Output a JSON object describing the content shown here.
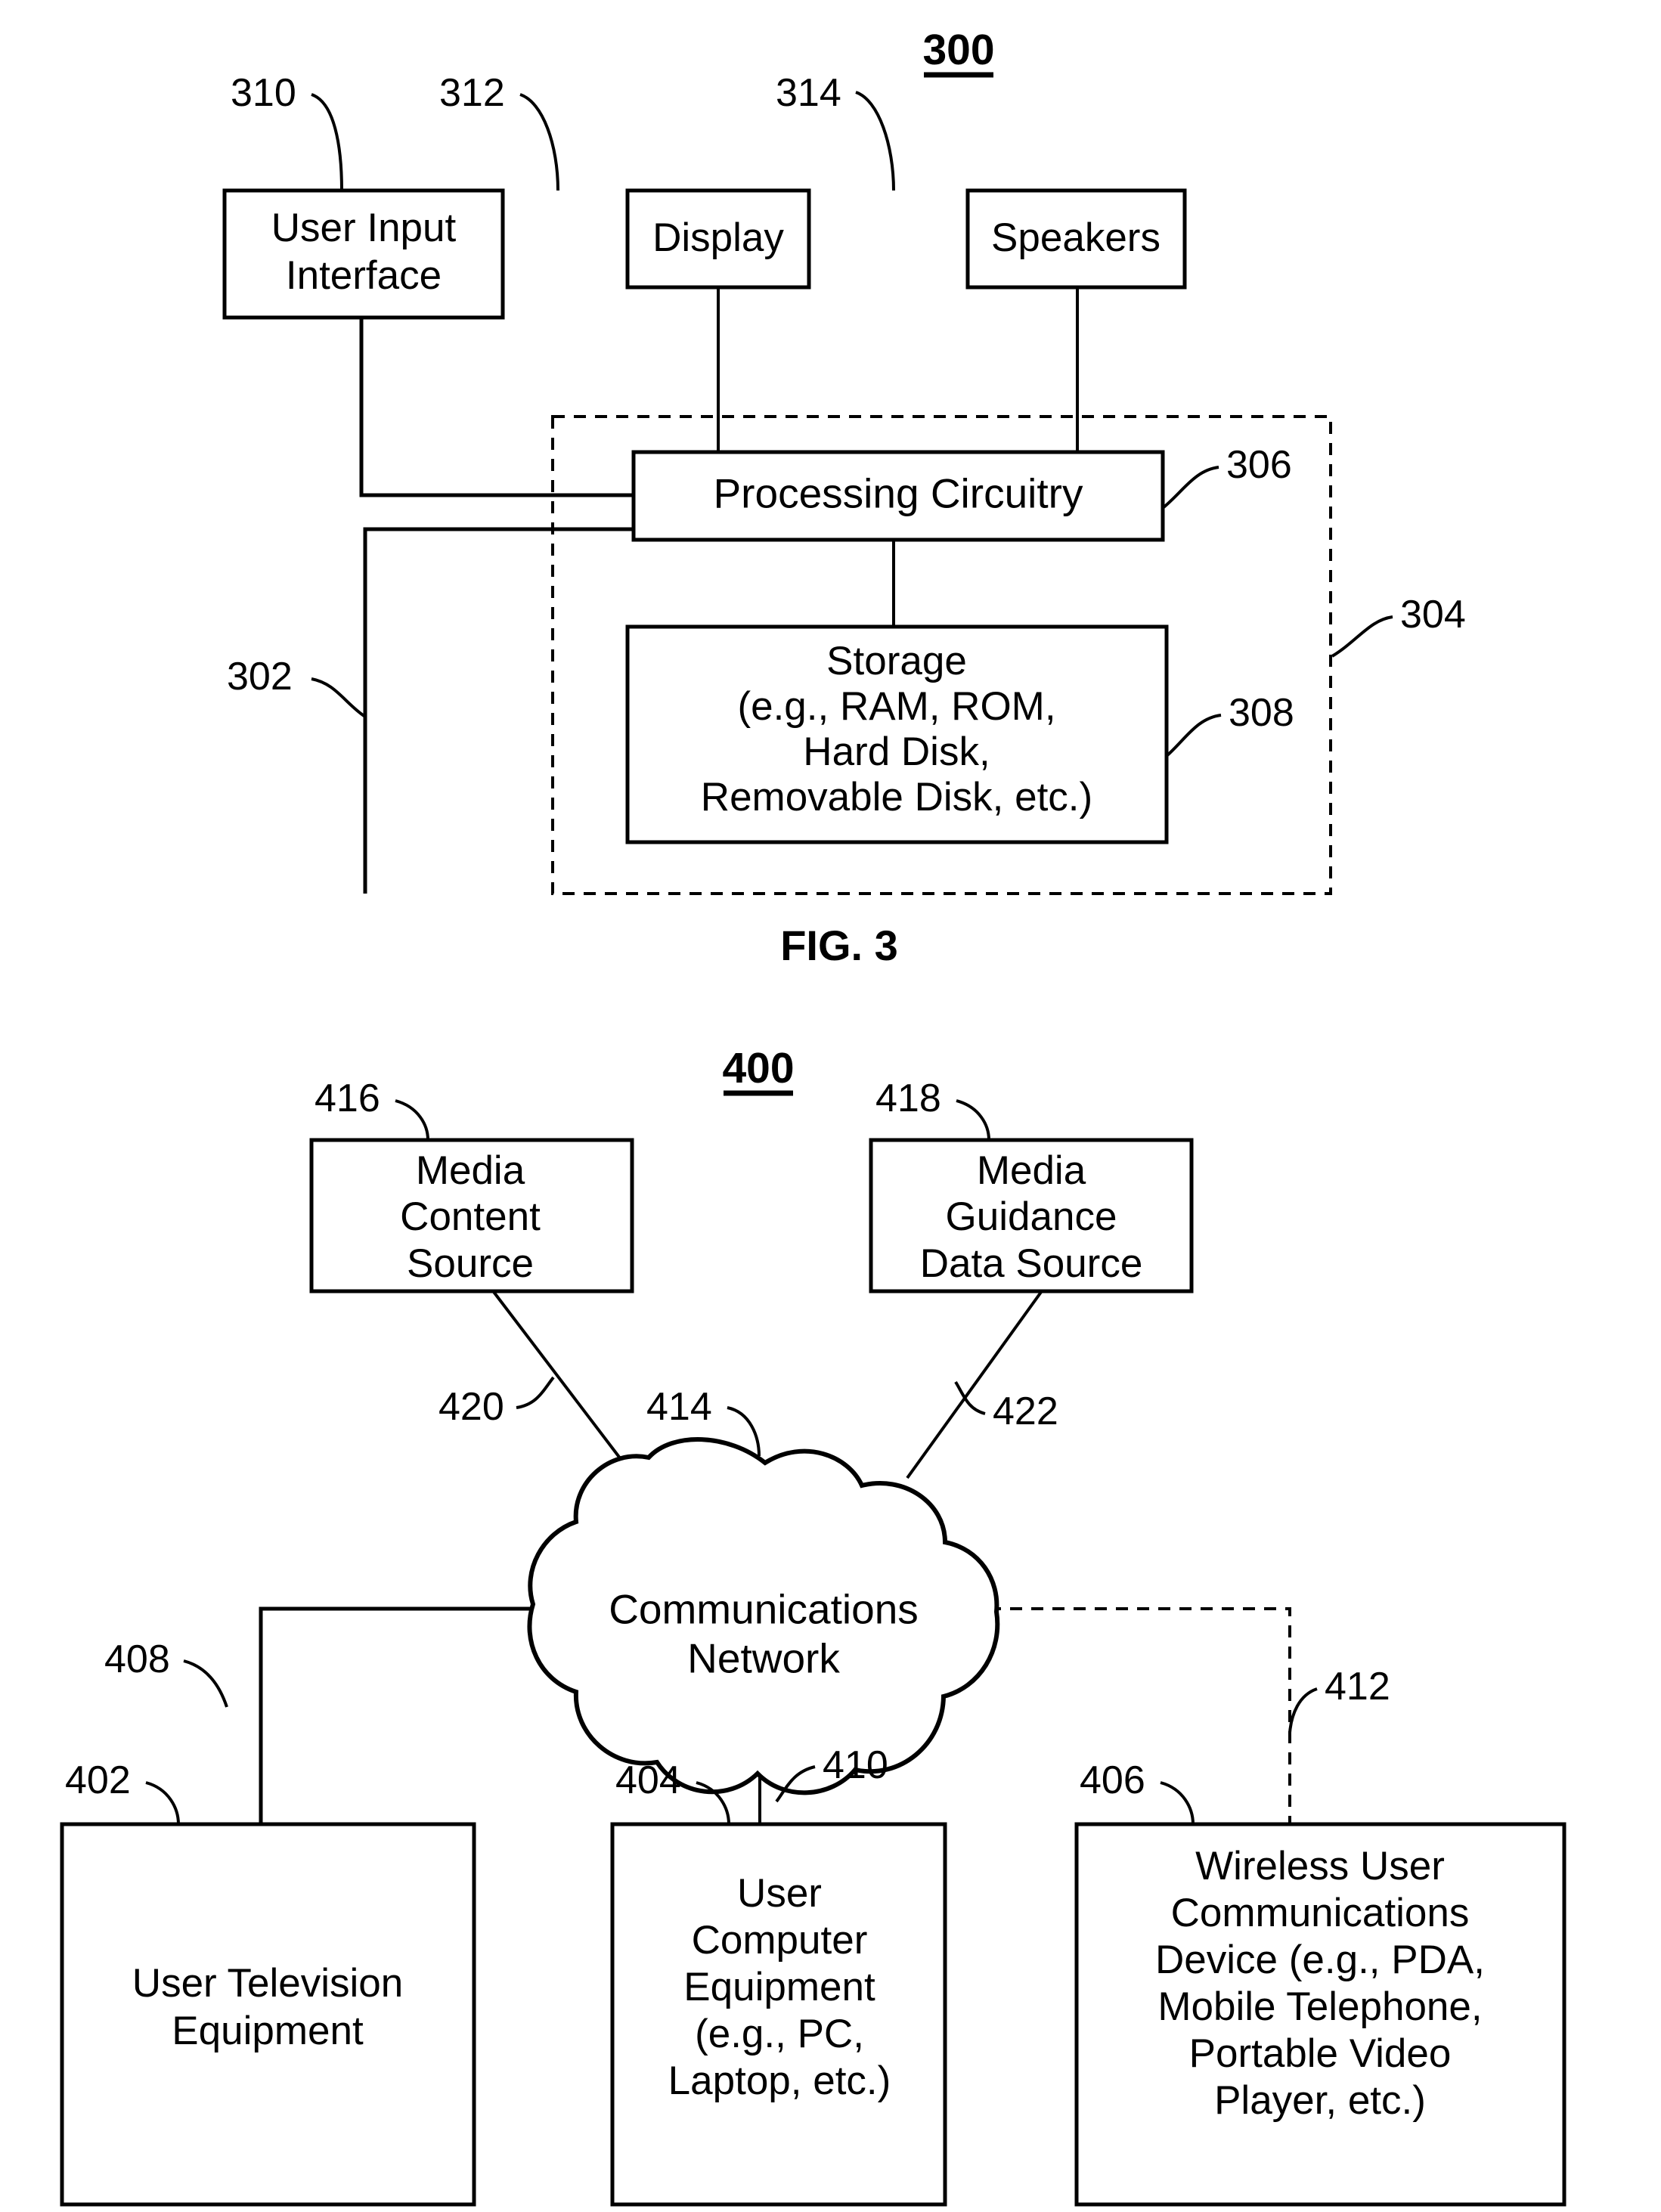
{
  "figure3": {
    "figure_number": "300",
    "caption": "FIG. 3",
    "boxes": {
      "user_input_interface": "User Input\nInterface",
      "user_input_interface_line1": "User Input",
      "user_input_interface_line2": "Interface",
      "display": "Display",
      "speakers": "Speakers",
      "processing_circuitry": "Processing Circuitry",
      "storage_line1": "Storage",
      "storage_line2": "(e.g., RAM, ROM,",
      "storage_line3": "Hard Disk,",
      "storage_line4": "Removable Disk, etc.)"
    },
    "reference_numerals": {
      "user_input_interface": "310",
      "display": "312",
      "speakers": "314",
      "processing_circuitry": "306",
      "storage": "308",
      "bus_line": "302",
      "control_circuitry": "304"
    }
  },
  "figure4": {
    "figure_number": "400",
    "boxes": {
      "media_content_source_line1": "Media",
      "media_content_source_line2": "Content",
      "media_content_source_line3": "Source",
      "media_guidance_data_source_line1": "Media",
      "media_guidance_data_source_line2": "Guidance",
      "media_guidance_data_source_line3": "Data Source",
      "communications_network_line1": "Communications",
      "communications_network_line2": "Network",
      "user_television_equipment_line1": "User Television",
      "user_television_equipment_line2": "Equipment",
      "user_computer_equipment_line1": "User",
      "user_computer_equipment_line2": "Computer",
      "user_computer_equipment_line3": "Equipment",
      "user_computer_equipment_line4": "(e.g., PC,",
      "user_computer_equipment_line5": "Laptop, etc.)",
      "wireless_user_comm_device_line1": "Wireless User",
      "wireless_user_comm_device_line2": "Communications",
      "wireless_user_comm_device_line3": "Device (e.g., PDA,",
      "wireless_user_comm_device_line4": "Mobile Telephone,",
      "wireless_user_comm_device_line5": "Portable Video",
      "wireless_user_comm_device_line6": "Player, etc.)"
    },
    "reference_numerals": {
      "media_content_source": "416",
      "media_guidance_data_source": "418",
      "communications_network": "414",
      "content_path": "420",
      "guidance_path": "422",
      "television_path": "408",
      "computer_path": "410",
      "wireless_path": "412",
      "user_television_equipment": "402",
      "user_computer_equipment": "404",
      "wireless_user_communications_device": "406"
    }
  },
  "colors": {
    "ink": "#000000",
    "paper": "#ffffff"
  }
}
